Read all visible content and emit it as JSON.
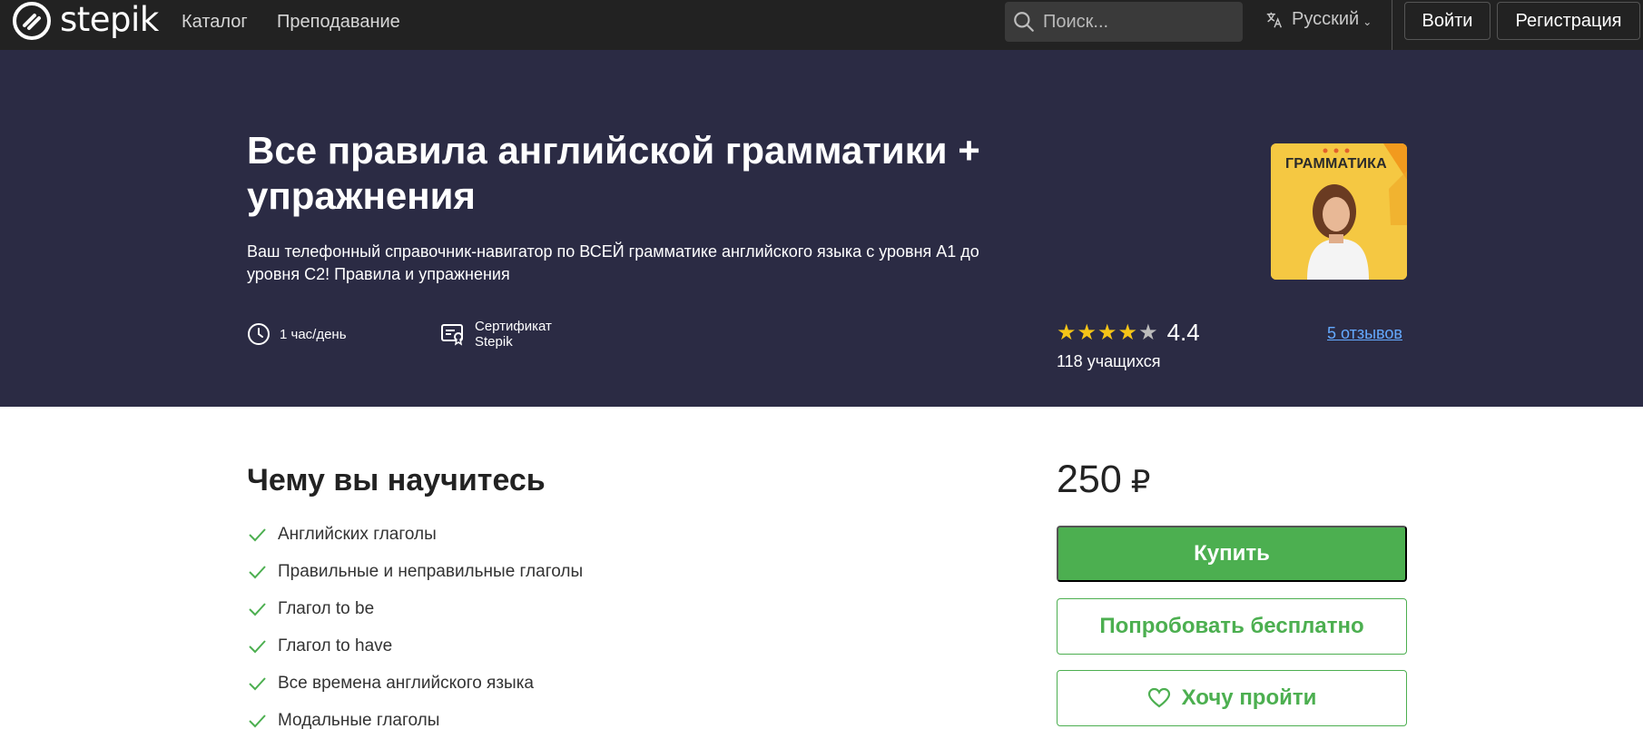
{
  "nav": {
    "logo_text": "stepik",
    "links": [
      "Каталог",
      "Преподавание"
    ],
    "search_placeholder": "Поиск...",
    "language": "Русский",
    "login": "Войти",
    "signup": "Регистрация"
  },
  "course": {
    "title": "Все правила английской грамматики + упражнения",
    "subtitle": "Ваш телефонный справочник-навигатор по ВСЕЙ грамматике английского языка с уровня А1 до уровня С2! Правила и упражнения",
    "workload": "1 час/день",
    "certificate_line1": "Сертификат",
    "certificate_line2": "Stepik",
    "cover_label": "ГРАММАТИКА",
    "rating": 4.4,
    "rating_label": "4.4",
    "learners": "118 учащихся",
    "reviews": "5 отзывов"
  },
  "learn": {
    "title": "Чему вы научитесь",
    "items": [
      "Английских глаголы",
      "Правильные и неправильные глаголы",
      "Глагол to be",
      "Глагол to have",
      "Все времена английского языка",
      "Модальные глаголы"
    ]
  },
  "purchase": {
    "price": "250",
    "currency": "₽",
    "buy": "Купить",
    "try_free": "Попробовать бесплатно",
    "wishlist": "Хочу пройти"
  },
  "colors": {
    "nav_bg": "#222222",
    "hero_bg": "#2b2b44",
    "accent_green": "#4caf50",
    "link_blue": "#64a9ff",
    "star": "#f5c518"
  }
}
